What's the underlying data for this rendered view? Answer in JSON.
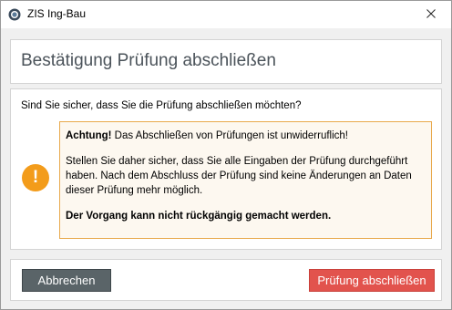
{
  "window": {
    "title": "ZIS Ing-Bau",
    "close_glyph": "✕"
  },
  "dialog": {
    "heading": "Bestätigung Prüfung abschließen",
    "question": "Sind Sie sicher, dass Sie die Prüfung abschließen möchten?",
    "warning": {
      "icon": "exclamation-icon",
      "icon_glyph": "!",
      "label": "Achtung!",
      "first_line": " Das Abschließen von Prüfungen ist unwiderruflich!",
      "paragraph": "Stellen Sie daher sicher, dass Sie alle Eingaben der Prüfung durchgeführt haben. Nach dem Abschluss der Prüfung sind keine Änderungen an Daten dieser Prüfung mehr möglich.",
      "final_note": "Der Vorgang kann nicht rückgängig gemacht werden."
    }
  },
  "footer": {
    "cancel_label": "Abbrechen",
    "confirm_label": "Prüfung abschließen"
  },
  "colors": {
    "warning_accent": "#f39c1b",
    "cancel_button": "#5a6468",
    "confirm_button": "#e2534d"
  }
}
